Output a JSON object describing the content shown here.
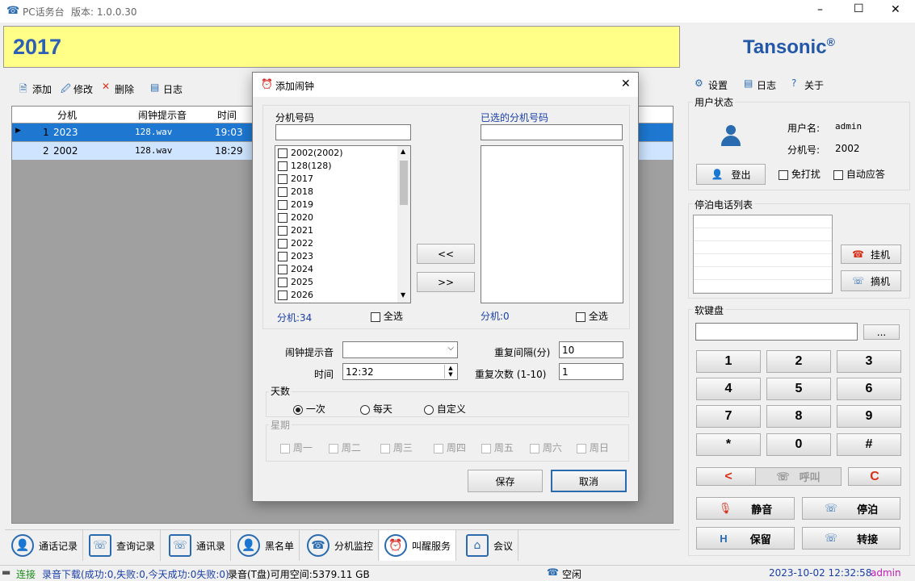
{
  "window": {
    "title": "PC话务台",
    "version": "版本: 1.0.0.30",
    "min": "–",
    "max": "☐",
    "close": "✕"
  },
  "header": {
    "extension": "2017",
    "brand": "Tansonic",
    "reg": "®"
  },
  "toolbar": {
    "add": "添加",
    "edit": "修改",
    "delete": "删除",
    "log": "日志"
  },
  "table": {
    "headers": [
      "分机",
      "闹钟提示音",
      "时间"
    ],
    "rows": [
      {
        "n": "1",
        "ext": "2023",
        "sound": "128.wav",
        "time": "19:03"
      },
      {
        "n": "2",
        "ext": "2002",
        "sound": "128.wav",
        "time": "18:29"
      }
    ]
  },
  "right_toolbar": {
    "settings": "设置",
    "log": "日志",
    "about": "关于"
  },
  "user_status": {
    "label": "用户状态",
    "username_label": "用户名:",
    "username": "admin",
    "ext_label": "分机号:",
    "ext": "2002",
    "logout": "登出",
    "dnd": "免打扰",
    "auto_answer": "自动应答"
  },
  "parked": {
    "label": "停泊电话列表",
    "hangup": "挂机",
    "pickup": "摘机"
  },
  "softkeys": {
    "label": "软键盘",
    "more": "...",
    "keys": [
      "1",
      "2",
      "3",
      "4",
      "5",
      "6",
      "7",
      "8",
      "9",
      "*",
      "0",
      "#"
    ],
    "back": "<",
    "call": "呼叫",
    "clear": "C",
    "mute": "静音",
    "park": "停泊",
    "hold": "保留",
    "transfer": "转接"
  },
  "tabs": [
    "通话记录",
    "查询记录",
    "通讯录",
    "黑名单",
    "分机监控",
    "叫醒服务",
    "会议"
  ],
  "statusbar": {
    "connected": "连接",
    "download": "录音下载(成功:0,失败:0,今天成功:0失败:0)",
    "space": "录音(T盘)可用空间:5379.11 GB",
    "idle": "空闲",
    "datetime": "2023-10-02 12:32:58",
    "user": "admin"
  },
  "dialog": {
    "title": "添加闹钟",
    "ext_label": "分机号码",
    "selected_label": "已选的分机号码",
    "ext_list": [
      "2002(2002)",
      "128(128)",
      "2017",
      "2018",
      "2019",
      "2020",
      "2021",
      "2022",
      "2023",
      "2024",
      "2025",
      "2026"
    ],
    "count_left": "分机:34",
    "count_right": "分机:0",
    "select_all": "全选",
    "move_left": "<<",
    "move_right": ">>",
    "sound_label": "闹钟提示音",
    "repeat_interval_label": "重复间隔(分)",
    "repeat_interval": "10",
    "time_label": "时间",
    "time": "12:32",
    "repeat_count_label": "重复次数 (1-10)",
    "repeat_count": "1",
    "days_label": "天数",
    "once": "一次",
    "daily": "每天",
    "custom": "自定义",
    "week_label": "星期",
    "weekdays": [
      "周一",
      "周二",
      "周三",
      "周四",
      "周五",
      "周六",
      "周日"
    ],
    "save": "保存",
    "cancel": "取消"
  }
}
